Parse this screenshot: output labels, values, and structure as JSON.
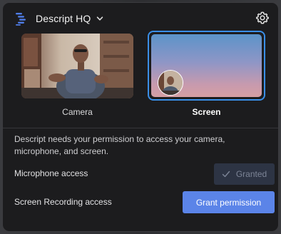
{
  "header": {
    "workspace_name": "Descript HQ",
    "icons": {
      "logo": "descript-logo",
      "dropdown": "chevron-down-icon",
      "settings": "gear-icon"
    }
  },
  "sources": {
    "camera_label": "Camera",
    "screen_label": "Screen",
    "selected": "Screen"
  },
  "permission": {
    "message": "Descript needs your permission to access your camera, microphone, and screen.",
    "microphone_label": "Microphone access",
    "microphone_status": "Granted",
    "screen_recording_label": "Screen Recording access",
    "grant_button": "Grant permission"
  },
  "colors": {
    "panel_bg": "#1c1c1e",
    "accent_selected": "#3a8fe8",
    "primary_button": "#5b84e8",
    "disabled_button": "#2d3444"
  }
}
